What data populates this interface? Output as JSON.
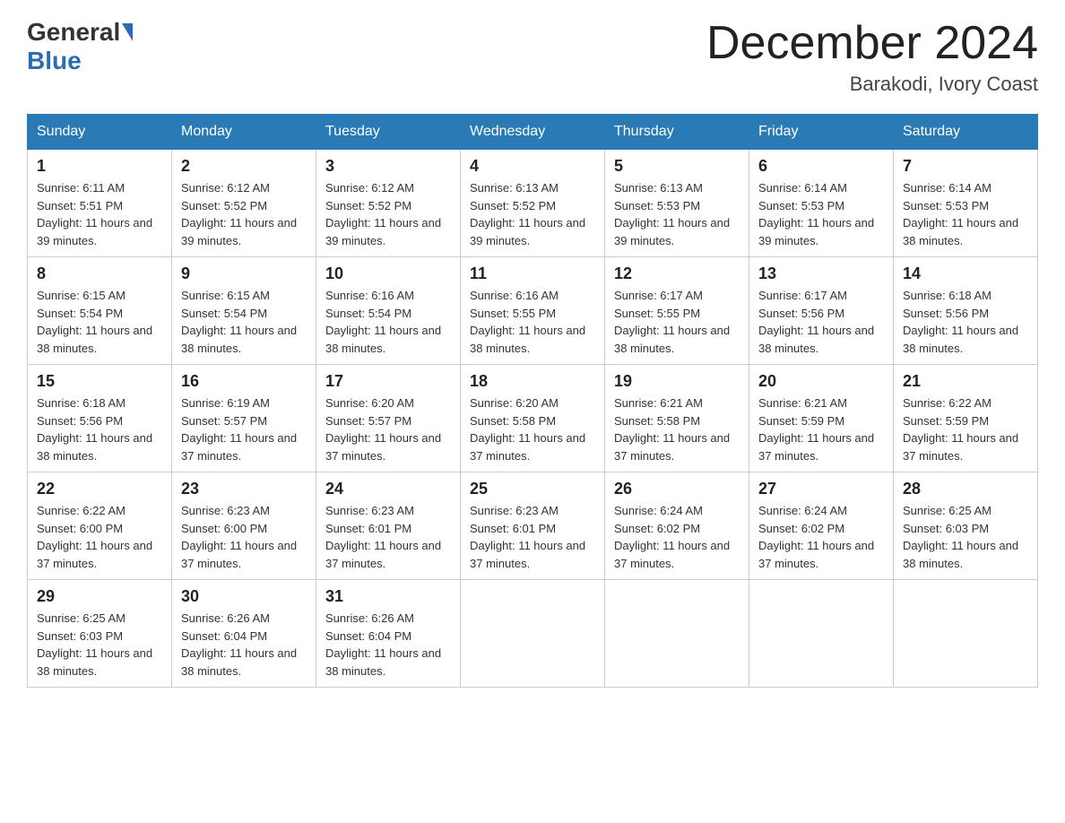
{
  "header": {
    "logo_general": "General",
    "logo_blue": "Blue",
    "month_title": "December 2024",
    "location": "Barakodi, Ivory Coast"
  },
  "days_of_week": [
    "Sunday",
    "Monday",
    "Tuesday",
    "Wednesday",
    "Thursday",
    "Friday",
    "Saturday"
  ],
  "weeks": [
    [
      {
        "day": "1",
        "sunrise": "Sunrise: 6:11 AM",
        "sunset": "Sunset: 5:51 PM",
        "daylight": "Daylight: 11 hours and 39 minutes."
      },
      {
        "day": "2",
        "sunrise": "Sunrise: 6:12 AM",
        "sunset": "Sunset: 5:52 PM",
        "daylight": "Daylight: 11 hours and 39 minutes."
      },
      {
        "day": "3",
        "sunrise": "Sunrise: 6:12 AM",
        "sunset": "Sunset: 5:52 PM",
        "daylight": "Daylight: 11 hours and 39 minutes."
      },
      {
        "day": "4",
        "sunrise": "Sunrise: 6:13 AM",
        "sunset": "Sunset: 5:52 PM",
        "daylight": "Daylight: 11 hours and 39 minutes."
      },
      {
        "day": "5",
        "sunrise": "Sunrise: 6:13 AM",
        "sunset": "Sunset: 5:53 PM",
        "daylight": "Daylight: 11 hours and 39 minutes."
      },
      {
        "day": "6",
        "sunrise": "Sunrise: 6:14 AM",
        "sunset": "Sunset: 5:53 PM",
        "daylight": "Daylight: 11 hours and 39 minutes."
      },
      {
        "day": "7",
        "sunrise": "Sunrise: 6:14 AM",
        "sunset": "Sunset: 5:53 PM",
        "daylight": "Daylight: 11 hours and 38 minutes."
      }
    ],
    [
      {
        "day": "8",
        "sunrise": "Sunrise: 6:15 AM",
        "sunset": "Sunset: 5:54 PM",
        "daylight": "Daylight: 11 hours and 38 minutes."
      },
      {
        "day": "9",
        "sunrise": "Sunrise: 6:15 AM",
        "sunset": "Sunset: 5:54 PM",
        "daylight": "Daylight: 11 hours and 38 minutes."
      },
      {
        "day": "10",
        "sunrise": "Sunrise: 6:16 AM",
        "sunset": "Sunset: 5:54 PM",
        "daylight": "Daylight: 11 hours and 38 minutes."
      },
      {
        "day": "11",
        "sunrise": "Sunrise: 6:16 AM",
        "sunset": "Sunset: 5:55 PM",
        "daylight": "Daylight: 11 hours and 38 minutes."
      },
      {
        "day": "12",
        "sunrise": "Sunrise: 6:17 AM",
        "sunset": "Sunset: 5:55 PM",
        "daylight": "Daylight: 11 hours and 38 minutes."
      },
      {
        "day": "13",
        "sunrise": "Sunrise: 6:17 AM",
        "sunset": "Sunset: 5:56 PM",
        "daylight": "Daylight: 11 hours and 38 minutes."
      },
      {
        "day": "14",
        "sunrise": "Sunrise: 6:18 AM",
        "sunset": "Sunset: 5:56 PM",
        "daylight": "Daylight: 11 hours and 38 minutes."
      }
    ],
    [
      {
        "day": "15",
        "sunrise": "Sunrise: 6:18 AM",
        "sunset": "Sunset: 5:56 PM",
        "daylight": "Daylight: 11 hours and 38 minutes."
      },
      {
        "day": "16",
        "sunrise": "Sunrise: 6:19 AM",
        "sunset": "Sunset: 5:57 PM",
        "daylight": "Daylight: 11 hours and 37 minutes."
      },
      {
        "day": "17",
        "sunrise": "Sunrise: 6:20 AM",
        "sunset": "Sunset: 5:57 PM",
        "daylight": "Daylight: 11 hours and 37 minutes."
      },
      {
        "day": "18",
        "sunrise": "Sunrise: 6:20 AM",
        "sunset": "Sunset: 5:58 PM",
        "daylight": "Daylight: 11 hours and 37 minutes."
      },
      {
        "day": "19",
        "sunrise": "Sunrise: 6:21 AM",
        "sunset": "Sunset: 5:58 PM",
        "daylight": "Daylight: 11 hours and 37 minutes."
      },
      {
        "day": "20",
        "sunrise": "Sunrise: 6:21 AM",
        "sunset": "Sunset: 5:59 PM",
        "daylight": "Daylight: 11 hours and 37 minutes."
      },
      {
        "day": "21",
        "sunrise": "Sunrise: 6:22 AM",
        "sunset": "Sunset: 5:59 PM",
        "daylight": "Daylight: 11 hours and 37 minutes."
      }
    ],
    [
      {
        "day": "22",
        "sunrise": "Sunrise: 6:22 AM",
        "sunset": "Sunset: 6:00 PM",
        "daylight": "Daylight: 11 hours and 37 minutes."
      },
      {
        "day": "23",
        "sunrise": "Sunrise: 6:23 AM",
        "sunset": "Sunset: 6:00 PM",
        "daylight": "Daylight: 11 hours and 37 minutes."
      },
      {
        "day": "24",
        "sunrise": "Sunrise: 6:23 AM",
        "sunset": "Sunset: 6:01 PM",
        "daylight": "Daylight: 11 hours and 37 minutes."
      },
      {
        "day": "25",
        "sunrise": "Sunrise: 6:23 AM",
        "sunset": "Sunset: 6:01 PM",
        "daylight": "Daylight: 11 hours and 37 minutes."
      },
      {
        "day": "26",
        "sunrise": "Sunrise: 6:24 AM",
        "sunset": "Sunset: 6:02 PM",
        "daylight": "Daylight: 11 hours and 37 minutes."
      },
      {
        "day": "27",
        "sunrise": "Sunrise: 6:24 AM",
        "sunset": "Sunset: 6:02 PM",
        "daylight": "Daylight: 11 hours and 37 minutes."
      },
      {
        "day": "28",
        "sunrise": "Sunrise: 6:25 AM",
        "sunset": "Sunset: 6:03 PM",
        "daylight": "Daylight: 11 hours and 38 minutes."
      }
    ],
    [
      {
        "day": "29",
        "sunrise": "Sunrise: 6:25 AM",
        "sunset": "Sunset: 6:03 PM",
        "daylight": "Daylight: 11 hours and 38 minutes."
      },
      {
        "day": "30",
        "sunrise": "Sunrise: 6:26 AM",
        "sunset": "Sunset: 6:04 PM",
        "daylight": "Daylight: 11 hours and 38 minutes."
      },
      {
        "day": "31",
        "sunrise": "Sunrise: 6:26 AM",
        "sunset": "Sunset: 6:04 PM",
        "daylight": "Daylight: 11 hours and 38 minutes."
      },
      null,
      null,
      null,
      null
    ]
  ]
}
